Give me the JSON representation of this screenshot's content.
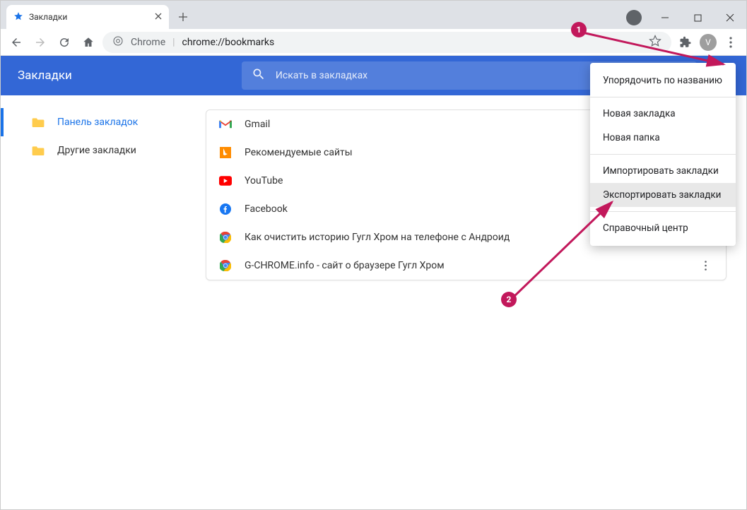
{
  "browser": {
    "tab_title": "Закладки",
    "omnibox_label": "Chrome",
    "omnibox_url": "chrome://bookmarks",
    "avatar_letter": "V"
  },
  "header": {
    "title": "Закладки",
    "search_placeholder": "Искать в закладках"
  },
  "sidebar": {
    "items": [
      {
        "label": "Панель закладок",
        "active": true
      },
      {
        "label": "Другие закладки",
        "active": false
      }
    ]
  },
  "bookmarks": [
    {
      "label": "Gmail",
      "icon": "gmail"
    },
    {
      "label": "Рекомендуемые сайты",
      "icon": "bing"
    },
    {
      "label": "YouTube",
      "icon": "youtube"
    },
    {
      "label": "Facebook",
      "icon": "facebook"
    },
    {
      "label": "Как очистить историю Гугл Хром на телефоне с Андроид",
      "icon": "chrome"
    },
    {
      "label": "G-CHROME.info - сайт о браузере Гугл Хром",
      "icon": "chrome"
    }
  ],
  "menu": {
    "items": [
      {
        "label": "Упорядочить по названию",
        "type": "item"
      },
      {
        "type": "sep"
      },
      {
        "label": "Новая закладка",
        "type": "item"
      },
      {
        "label": "Новая папка",
        "type": "item"
      },
      {
        "type": "sep"
      },
      {
        "label": "Импортировать закладки",
        "type": "item"
      },
      {
        "label": "Экспортировать закладки",
        "type": "item",
        "highlighted": true
      },
      {
        "type": "sep"
      },
      {
        "label": "Справочный центр",
        "type": "item"
      }
    ]
  },
  "annotations": {
    "badge1": "1",
    "badge2": "2"
  }
}
